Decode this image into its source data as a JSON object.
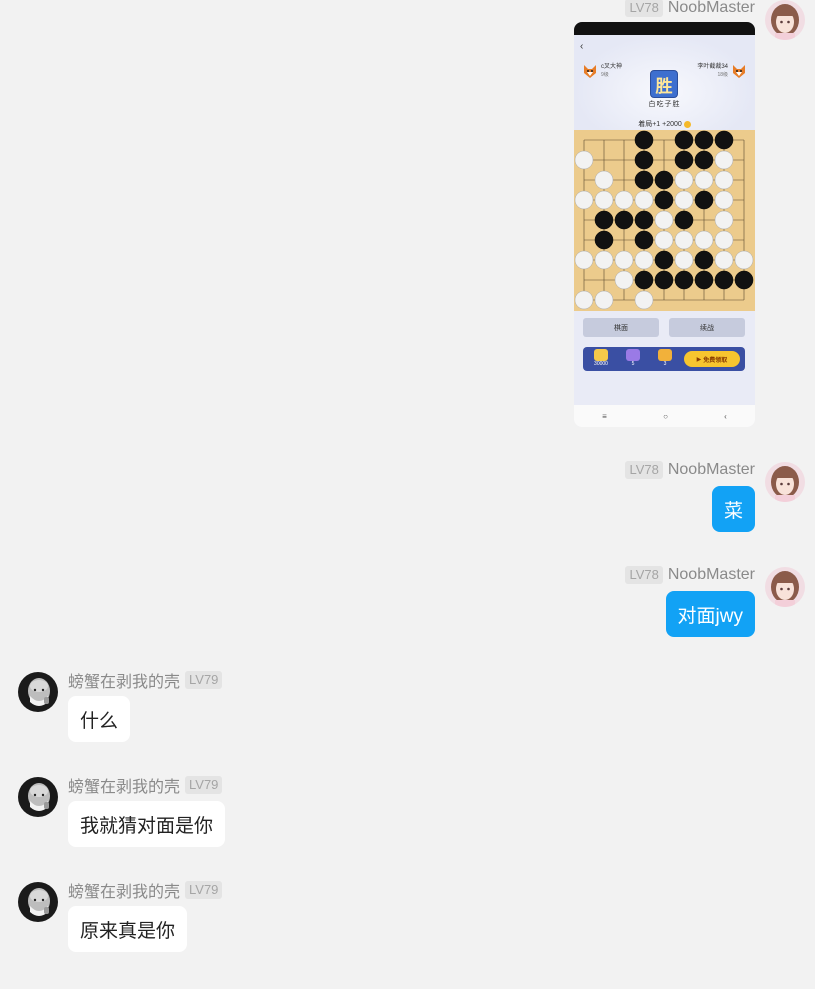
{
  "me": {
    "level": "LV78",
    "name": "NoobMaster"
  },
  "other": {
    "level": "LV79",
    "name": "螃蟹在剥我的壳"
  },
  "messages": [
    {
      "type": "image"
    },
    {
      "type": "text",
      "text": "菜"
    },
    {
      "type": "text",
      "text": "对面jwy"
    },
    {
      "type": "text",
      "text": "什么"
    },
    {
      "type": "text",
      "text": "我就猜对面是你"
    },
    {
      "type": "text",
      "text": "原来真是你"
    }
  ],
  "game_screenshot": {
    "back": "‹",
    "left_player": {
      "name": "c叉大神",
      "level": "9级"
    },
    "right_player": {
      "name": "李叶截裁34",
      "level": "18级"
    },
    "result": "胜",
    "reason": "白吃子胜",
    "score_text": "着局+1  +2000",
    "button_left": "棋面",
    "button_right": "续战",
    "rewards": [
      {
        "count": "30000"
      },
      {
        "count": "5"
      },
      {
        "count": "3"
      }
    ],
    "claim_label": "免费领取",
    "nav": [
      "≡",
      "○",
      "‹"
    ],
    "colors": {
      "board": "#eccb8c",
      "black": "#111111",
      "white": "#f2f2f2"
    }
  },
  "icons": {
    "me_avatar": "anime-girl-avatar",
    "other_avatar": "old-man-bw-avatar"
  },
  "colors": {
    "accent": "#12a2f5",
    "background": "#f2f2f2",
    "bubble_theirs": "#ffffff"
  }
}
